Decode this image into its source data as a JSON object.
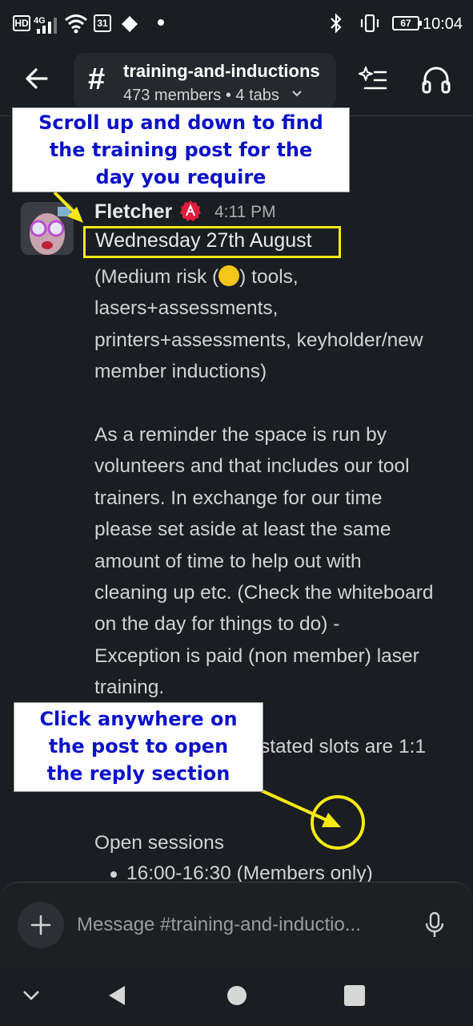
{
  "status_bar": {
    "hd": "HD",
    "network": "4G",
    "calendar_day": "31",
    "battery": "67",
    "time": "10:04"
  },
  "header": {
    "channel_name": "training-and-inductions",
    "channel_meta": "473 members • 4 tabs",
    "icons": [
      "back-arrow-icon",
      "hash-icon",
      "chevron-down-icon",
      "summary-icon",
      "headphones-icon"
    ]
  },
  "message": {
    "sender": "Fletcher",
    "timestamp": "4:11 PM",
    "date_line": "Wednesday 27th August",
    "lines_block1": [
      "(Medium risk (",
      ") tools,",
      "lasers+assessments,",
      "printers+assessments, keyholder/new",
      "member inductions)"
    ],
    "lines_block2": [
      "As a reminder the space is run by",
      "volunteers and that includes our tool",
      "trainers. In exchange for our time",
      "please set aside at least the same",
      "amount of time to help out with",
      "cleaning up etc. (Check the whiteboard",
      "on the day for things to do) -",
      "Exception is paid (non member) laser",
      "training."
    ],
    "partial_line": "stated slots are 1:1",
    "open_sessions_label": "Open sessions",
    "session_item": "16:00-16:30 (Members only)"
  },
  "annotations": {
    "top_callout": [
      "Scroll up and down to find",
      "the training post for the",
      "day you require"
    ],
    "bottom_callout": [
      "Click anywhere on",
      "the post to open",
      "the reply section"
    ]
  },
  "composer": {
    "placeholder": "Message #training-and-inductio..."
  },
  "colors": {
    "background": "#1a1d21",
    "annotation_yellow": "#f5ea14",
    "annotation_text": "#0b12c9",
    "badge_red": "#e01e3c"
  }
}
